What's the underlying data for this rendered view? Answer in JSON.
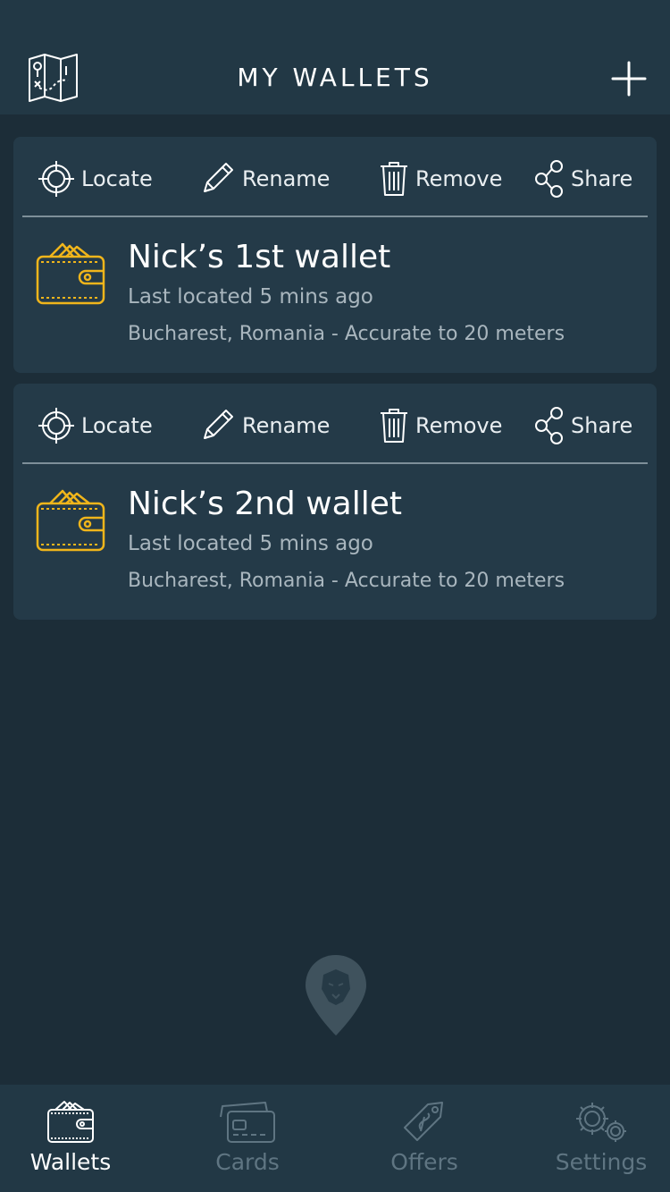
{
  "header": {
    "title": "MY WALLETS",
    "left_icon": "map-icon",
    "right_icon": "plus-icon"
  },
  "actions": {
    "locate": "Locate",
    "rename": "Rename",
    "remove": "Remove",
    "share": "Share"
  },
  "wallets": [
    {
      "name": "Nick’s 1st wallet",
      "last_located": "Last located 5 mins ago",
      "location": "Bucharest, Romania - Accurate to 20 meters"
    },
    {
      "name": "Nick’s 2nd wallet",
      "last_located": "Last located 5 mins ago",
      "location": "Bucharest, Romania - Accurate to 20 meters"
    }
  ],
  "tabs": [
    {
      "label": "Wallets",
      "icon": "wallet-icon",
      "active": true
    },
    {
      "label": "Cards",
      "icon": "card-icon",
      "active": false
    },
    {
      "label": "Offers",
      "icon": "tag-icon",
      "active": false
    },
    {
      "label": "Settings",
      "icon": "gear-icon",
      "active": false
    }
  ],
  "colors": {
    "background": "#1c2d38",
    "surface": "#243a48",
    "accent": "#f0b51b",
    "muted": "#5f7582"
  }
}
